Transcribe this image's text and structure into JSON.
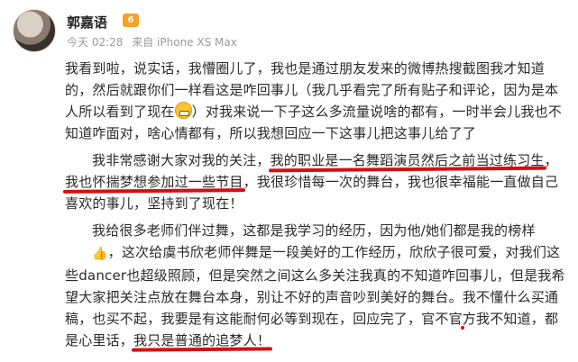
{
  "post": {
    "author": "郭嘉语",
    "vip_badge": "6",
    "time": "今天 02:28",
    "source": "来自 iPhone XS Max",
    "p1": "我看到啦，说实话，我懵圈儿了，我也是通过朋友发来的微博热搜截图我才知道的，然后就跟你们一样看这是咋回事儿（我几乎看完了所有贴子和评论，因为是本人所以看到了现在",
    "p1_tail": "）对我来说一下子这么多流量说啥的都有，一时半会儿我也不知道咋面对，啥心情都有，所以我想回应一下这事儿把这事儿给了了",
    "p2_a": "我非常感谢大家对我的关注，",
    "p2_u1": "我的职业是一名舞蹈演员然后之前当过练习生",
    "p2_b": "，",
    "p2_u2": "我也怀揣梦想参加过一些节目",
    "p2_c": "，我很珍惜每一次的舞台，我也很幸福能一直做自己喜欢的事儿，坚持到了现在！",
    "p3_a": "我给很多老师们伴过舞，这都是我学习的经历，因为他/她们都是我的榜样",
    "p3_b": "，这次给虞书欣老师伴舞是一段美好的工作经历，欣欣子很可爱，对我们这些dancer也超级照顾，但是突然之间这么多关注我真的不知道咋回事儿，但是我希望大家把关注点放在舞台本身，别让不好的声音吵到美好的舞台。",
    "p3_u1": "我不懂什么买通稿，也买不起",
    "p3_c": "，我要是有这能耐何必等到现在，回应完了，官不官方我不知道，都是心里话，",
    "p3_u2": "我只是普通的追梦人！"
  }
}
